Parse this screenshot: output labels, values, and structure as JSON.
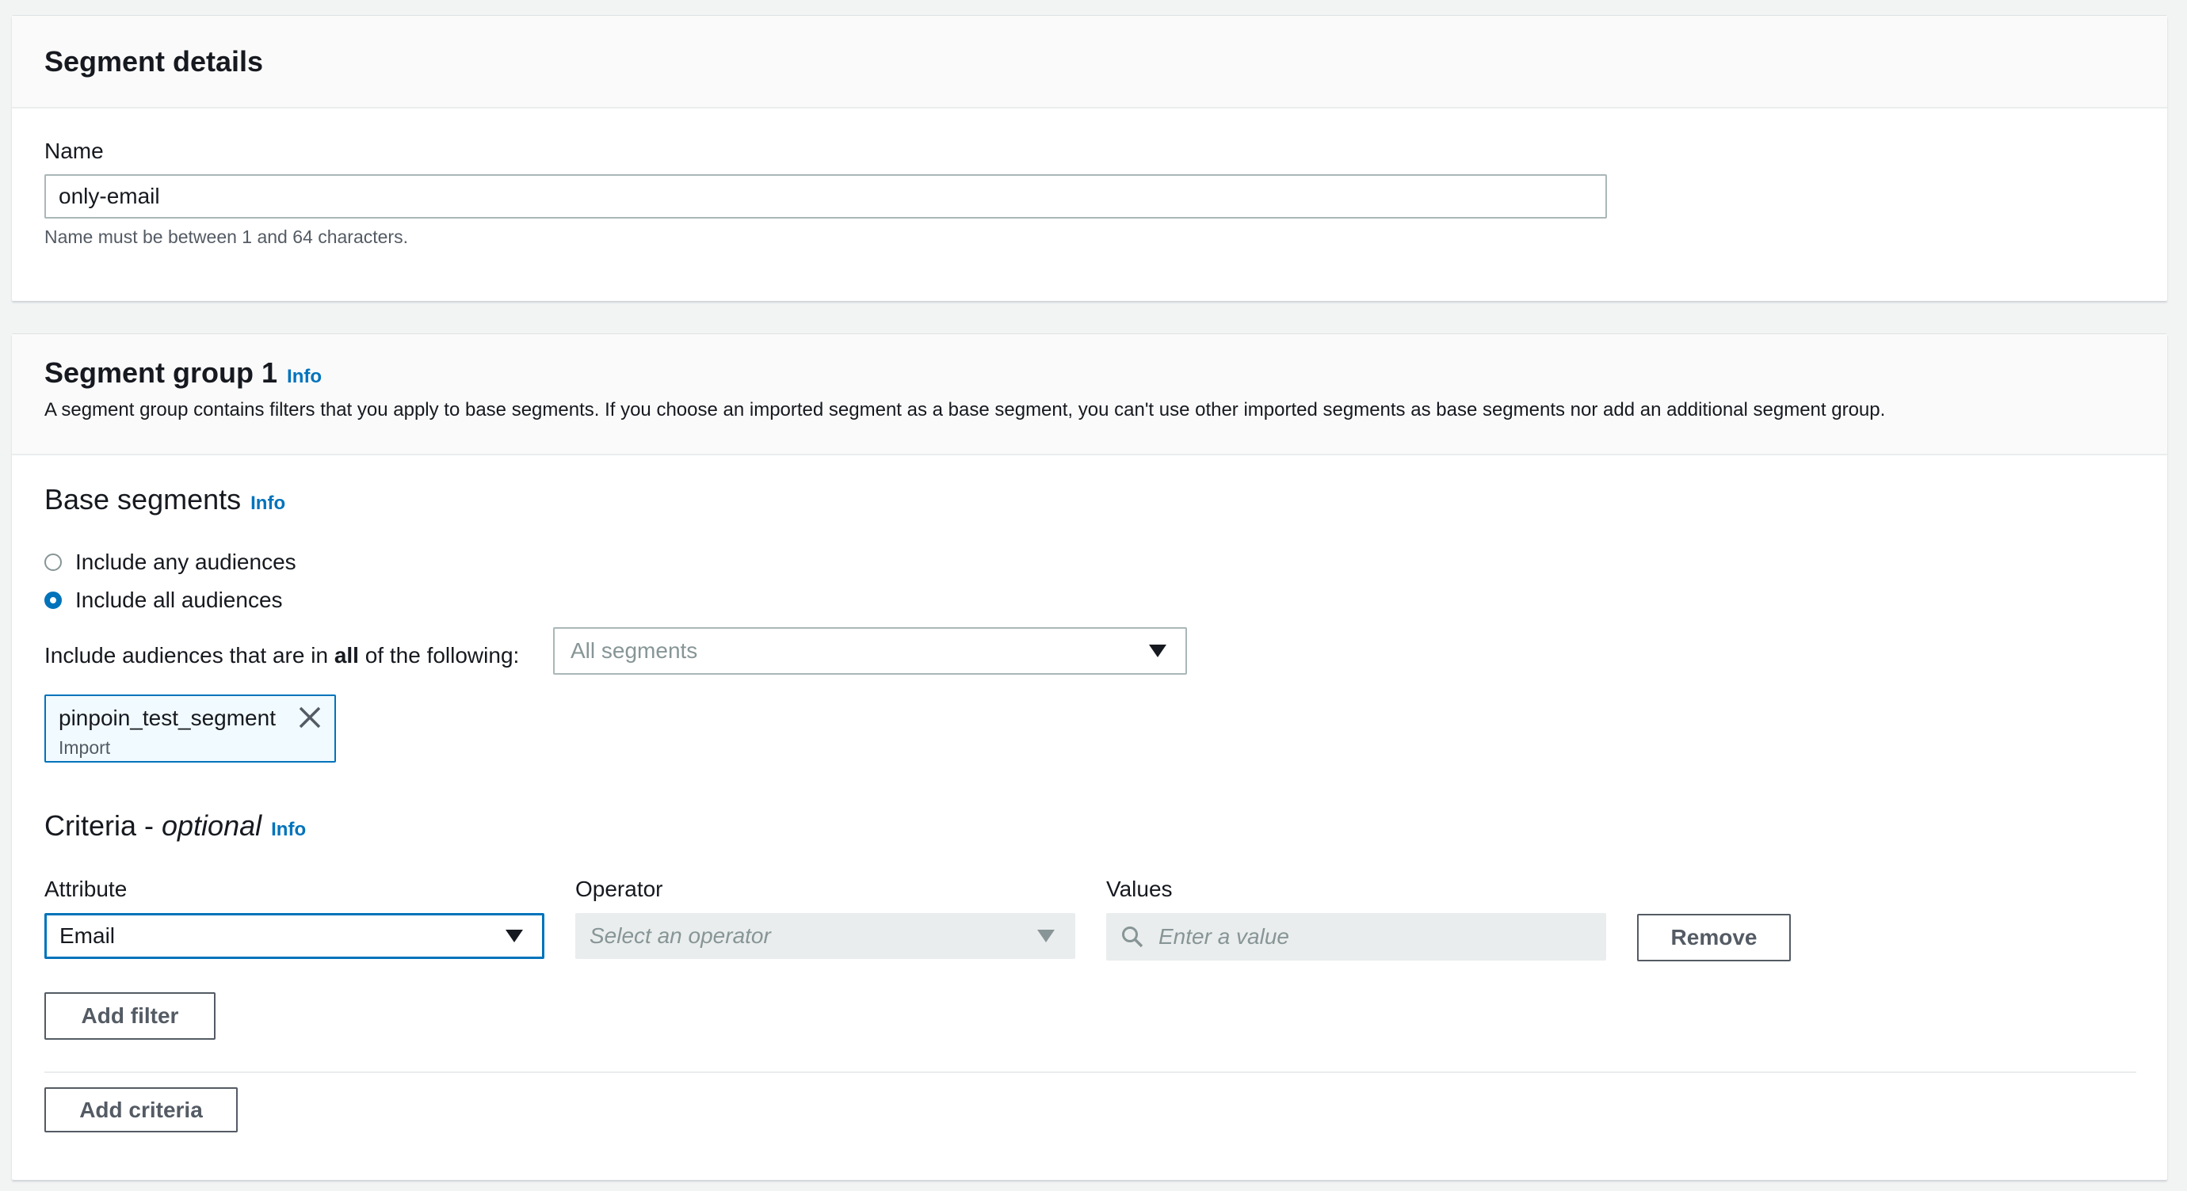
{
  "segment_details": {
    "title": "Segment details",
    "name_label": "Name",
    "name_value": "only-email",
    "name_helper": "Name must be between 1 and 64 characters."
  },
  "segment_group": {
    "title": "Segment group 1",
    "info": "Info",
    "description": "A segment group contains filters that you apply to base segments. If you choose an imported segment as a base segment, you can't use other imported segments as base segments nor add an additional segment group.",
    "base_segments": {
      "title": "Base segments",
      "info": "Info",
      "radio_any": "Include any audiences",
      "radio_all": "Include all audiences",
      "include_prefix": "Include audiences that are in ",
      "include_bold": "all",
      "include_suffix": " of the following:",
      "select_placeholder": "All segments",
      "token_name": "pinpoin_test_segment",
      "token_sub": "Import"
    },
    "criteria": {
      "title": "Criteria - ",
      "title_italic": "optional",
      "info": "Info",
      "attribute_label": "Attribute",
      "attribute_value": "Email",
      "operator_label": "Operator",
      "operator_placeholder": "Select an operator",
      "values_label": "Values",
      "values_placeholder": "Enter a value",
      "remove_button": "Remove",
      "add_filter_button": "Add filter",
      "add_criteria_button": "Add criteria"
    }
  },
  "colors": {
    "link": "#0073bb",
    "selected_border": "#0073bb",
    "token_bg": "#f1faff",
    "disabled_bg": "#eaeded"
  }
}
